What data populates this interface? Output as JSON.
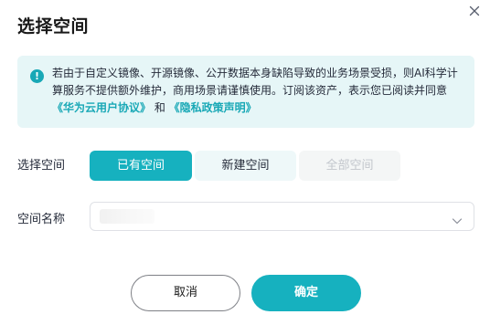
{
  "dialog": {
    "title": "选择空间",
    "close_icon": "close-icon"
  },
  "notice": {
    "icon": "exclamation-icon",
    "line1": "若由于自定义镜像、开源镜像、公开数据本身缺陷导致的业务场景受损，则AI科学计",
    "line2": "算服务不提供额外维护，商用场景请谨慎使用。订阅该资产，表示您已阅读并同意",
    "link_agreement": "《华为云用户协议》",
    "and_text": " 和 ",
    "link_privacy": "《隐私政策声明》"
  },
  "space_select": {
    "label": "选择空间",
    "options": [
      "已有空间",
      "新建空间",
      "全部空间"
    ],
    "selected": "已有空间",
    "disabled": "全部空间"
  },
  "space_name": {
    "label": "空间名称",
    "value": "",
    "chevron_icon": "chevron-down-icon"
  },
  "buttons": {
    "cancel": "取消",
    "confirm": "确定"
  },
  "colors": {
    "accent": "#16b1bf",
    "link": "#18a8b6",
    "notice_bg": "#e6f6f7",
    "segment_bg": "#eef8f9",
    "disabled_text": "#c2c6cc"
  }
}
